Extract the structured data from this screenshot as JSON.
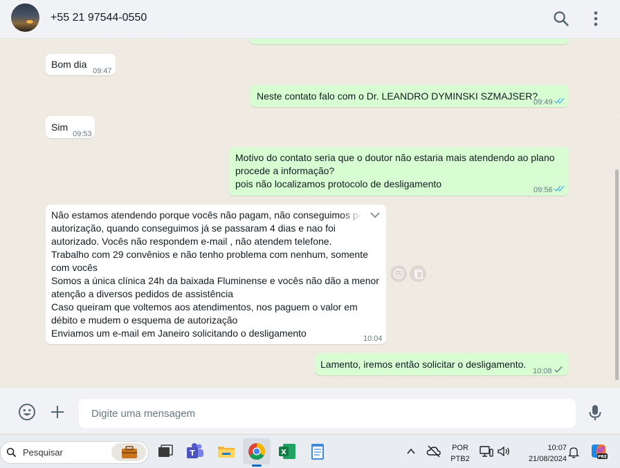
{
  "header": {
    "contact": "+55 21 97544-0550",
    "icons": [
      "avatar",
      "search-icon",
      "menu-dots-icon"
    ]
  },
  "messages": [
    {
      "direction": "in",
      "text": "Bom dia",
      "time": "09:47"
    },
    {
      "direction": "out",
      "text": "Neste contato falo com o Dr. LEANDRO DYMINSKI SZMAJSER?",
      "time": "09:49",
      "status": "read"
    },
    {
      "direction": "in",
      "text": "Sim",
      "time": "09:53"
    },
    {
      "direction": "out",
      "lines": [
        "Motivo do contato seria que o doutor não estaria mais atendendo ao plano",
        "procede a informação?",
        "pois não localizamos protocolo de desligamento"
      ],
      "time": "09:56",
      "status": "read"
    },
    {
      "direction": "in",
      "lines": [
        "Não estamos atendendo porque vocês não pagam, não conseguimos pe",
        "autorização, quando conseguimos já se passaram 4 dias e nao foi",
        "autorizado. Vocês não respondem e-mail , não atendem telefone.",
        "Trabalho com 29 convênios e não tenho problema com nenhum, somente",
        "com vocês",
        "Somos a única clínica 24h da baixada Fluminense e vocês não dão a menor",
        "atenção a diversos pedidos de assistência",
        "Caso queiram que voltemos aos atendimentos, nos paguem o valor em",
        "débito e mudem o esquema de autorização",
        "Enviamos um e-mail em Janeiro solicitando o desligamento"
      ],
      "time": "10:04"
    },
    {
      "direction": "out",
      "text": "Lamento, iremos então solicitar o desligamento.",
      "time": "10:08",
      "status": "sent"
    }
  ],
  "composer": {
    "placeholder": "Digite uma mensagem",
    "icons": [
      "emoji-icon",
      "plus-icon",
      "mic-icon"
    ]
  },
  "taskbar": {
    "search_placeholder": "Pesquisar",
    "lang_line1": "POR",
    "lang_line2": "PTB2",
    "time": "10:07",
    "date": "21/08/2024",
    "apps": [
      "briefcase-icon",
      "task-view-icon",
      "teams-icon",
      "file-explorer-icon",
      "chrome-icon",
      "excel-icon",
      "notepad-icon"
    ]
  },
  "colors": {
    "incoming_bubble": "#ffffff",
    "outgoing_bubble": "#d9fdd3",
    "read_ticks": "#53bdeb",
    "chat_background": "#efeae2"
  }
}
